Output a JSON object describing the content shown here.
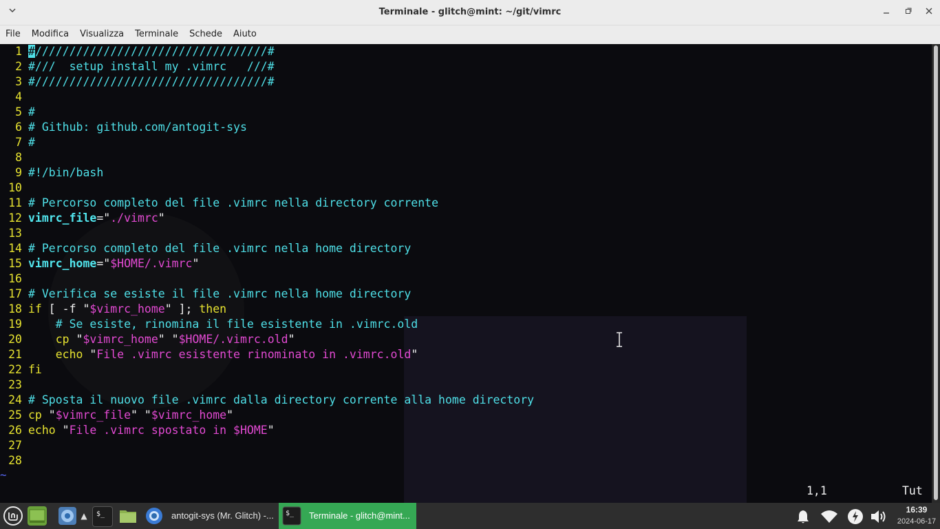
{
  "window": {
    "title": "Terminale - glitch@mint: ~/git/vimrc"
  },
  "menu": [
    "File",
    "Modifica",
    "Visualizza",
    "Terminale",
    "Schede",
    "Aiuto"
  ],
  "editor": {
    "lines": [
      {
        "n": "1",
        "segs": [
          {
            "c": "cursor",
            "t": "#"
          },
          {
            "c": "c",
            "t": "//////////////////////////////////#"
          }
        ]
      },
      {
        "n": "2",
        "segs": [
          {
            "c": "c",
            "t": "#///  setup install my .vimrc   ///#"
          }
        ]
      },
      {
        "n": "3",
        "segs": [
          {
            "c": "c",
            "t": "#//////////////////////////////////#"
          }
        ]
      },
      {
        "n": "4",
        "segs": []
      },
      {
        "n": "5",
        "segs": [
          {
            "c": "c",
            "t": "#"
          }
        ]
      },
      {
        "n": "6",
        "segs": [
          {
            "c": "c",
            "t": "# Github: github.com/antogit-sys"
          }
        ]
      },
      {
        "n": "7",
        "segs": [
          {
            "c": "c",
            "t": "#"
          }
        ]
      },
      {
        "n": "8",
        "segs": []
      },
      {
        "n": "9",
        "segs": [
          {
            "c": "c",
            "t": "#!/bin/bash"
          }
        ]
      },
      {
        "n": "10",
        "segs": []
      },
      {
        "n": "11",
        "segs": [
          {
            "c": "c",
            "t": "# Percorso completo del file .vimrc nella directory corrente"
          }
        ]
      },
      {
        "n": "12",
        "segs": [
          {
            "c": "v",
            "t": "vimrc_file"
          },
          {
            "c": "p",
            "t": "=\""
          },
          {
            "c": "s",
            "t": "./vimrc"
          },
          {
            "c": "p",
            "t": "\""
          }
        ]
      },
      {
        "n": "13",
        "segs": []
      },
      {
        "n": "14",
        "segs": [
          {
            "c": "c",
            "t": "# Percorso completo del file .vimrc nella home directory"
          }
        ]
      },
      {
        "n": "15",
        "segs": [
          {
            "c": "v",
            "t": "vimrc_home"
          },
          {
            "c": "p",
            "t": "=\""
          },
          {
            "c": "s",
            "t": "$HOME/.vimrc"
          },
          {
            "c": "p",
            "t": "\""
          }
        ]
      },
      {
        "n": "16",
        "segs": []
      },
      {
        "n": "17",
        "segs": [
          {
            "c": "c",
            "t": "# Verifica se esiste il file .vimrc nella home directory"
          }
        ]
      },
      {
        "n": "18",
        "segs": [
          {
            "c": "y",
            "t": "if"
          },
          {
            "c": "p",
            "t": " [ -f \""
          },
          {
            "c": "s",
            "t": "$vimrc_home"
          },
          {
            "c": "p",
            "t": "\" ]; "
          },
          {
            "c": "y",
            "t": "then"
          }
        ]
      },
      {
        "n": "19",
        "segs": [
          {
            "c": "c",
            "t": "    # Se esiste, rinomina il file esistente in .vimrc.old"
          }
        ]
      },
      {
        "n": "20",
        "segs": [
          {
            "c": "y",
            "t": "    cp"
          },
          {
            "c": "p",
            "t": " \""
          },
          {
            "c": "s",
            "t": "$vimrc_home"
          },
          {
            "c": "p",
            "t": "\" \""
          },
          {
            "c": "s",
            "t": "$HOME/.vimrc.old"
          },
          {
            "c": "p",
            "t": "\""
          }
        ]
      },
      {
        "n": "21",
        "segs": [
          {
            "c": "y",
            "t": "    echo"
          },
          {
            "c": "p",
            "t": " \""
          },
          {
            "c": "s",
            "t": "File .vimrc esistente rinominato in .vimrc.old"
          },
          {
            "c": "p",
            "t": "\""
          }
        ]
      },
      {
        "n": "22",
        "segs": [
          {
            "c": "y",
            "t": "fi"
          }
        ]
      },
      {
        "n": "23",
        "segs": []
      },
      {
        "n": "24",
        "segs": [
          {
            "c": "c",
            "t": "# Sposta il nuovo file .vimrc dalla directory corrente alla home directory"
          }
        ]
      },
      {
        "n": "25",
        "segs": [
          {
            "c": "y",
            "t": "cp"
          },
          {
            "c": "p",
            "t": " \""
          },
          {
            "c": "s",
            "t": "$vimrc_file"
          },
          {
            "c": "p",
            "t": "\" \""
          },
          {
            "c": "s",
            "t": "$vimrc_home"
          },
          {
            "c": "p",
            "t": "\""
          }
        ]
      },
      {
        "n": "26",
        "segs": [
          {
            "c": "y",
            "t": "echo"
          },
          {
            "c": "p",
            "t": " \""
          },
          {
            "c": "s",
            "t": "File .vimrc spostato in "
          },
          {
            "c": "s",
            "t": "$HOME"
          },
          {
            "c": "p",
            "t": "\""
          }
        ]
      },
      {
        "n": "27",
        "segs": []
      },
      {
        "n": "28",
        "segs": []
      }
    ],
    "tilde": "~",
    "position": "1,1",
    "scroll": "Tut"
  },
  "taskbar": {
    "tasks": [
      {
        "label": "antogit-sys (Mr. Glitch) -..."
      },
      {
        "label": "Terminale - glitch@mint..."
      }
    ],
    "clock_time": "16:39",
    "clock_date": "2024-06-17"
  }
}
